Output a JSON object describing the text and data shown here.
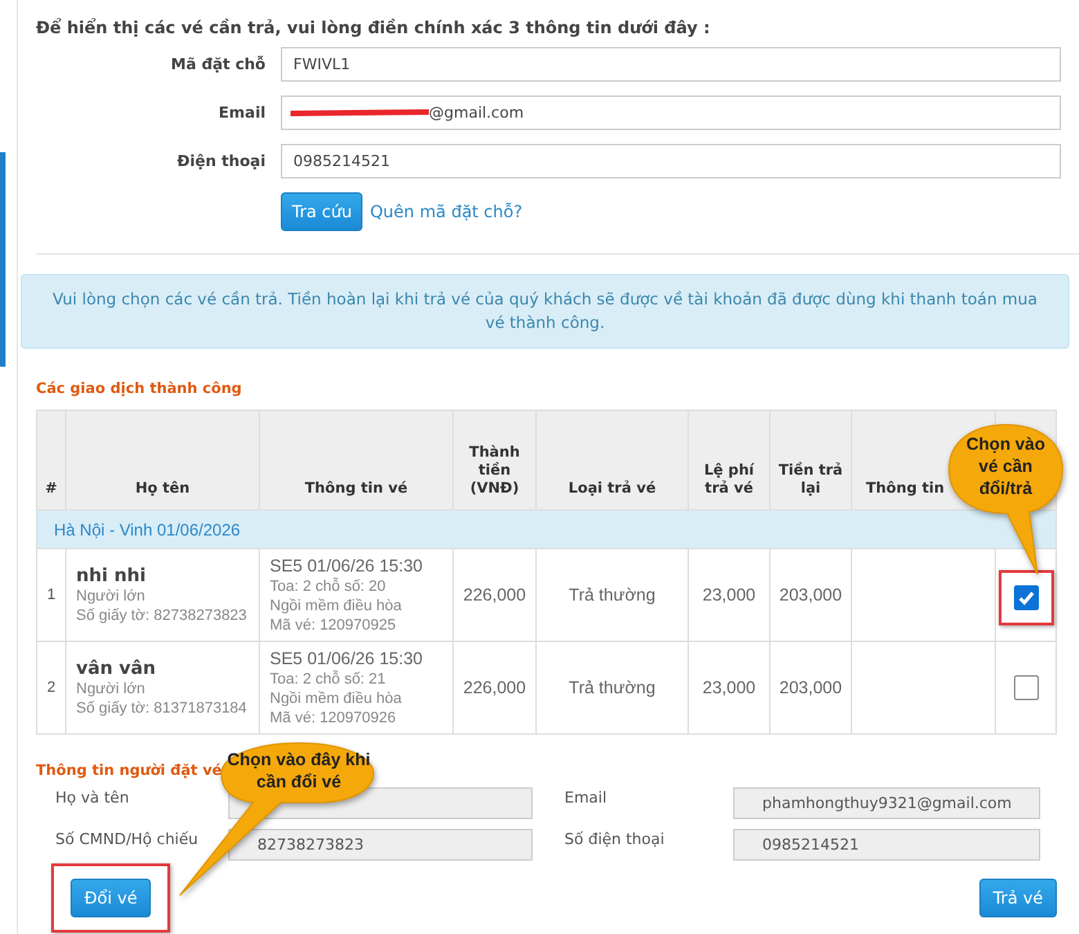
{
  "instructions": "Để hiển thị các vé cần trả, vui lòng điền chính xác 3 thông tin dưới đây :",
  "lookup_form": {
    "fields": [
      {
        "label": "Mã đặt chỗ",
        "value": "FWIVL1",
        "redacted": false
      },
      {
        "label": "Email",
        "value": "@gmail.com",
        "redacted": true
      },
      {
        "label": "Điện thoại",
        "value": "0985214521",
        "redacted": false
      }
    ],
    "search_button": "Tra cứu",
    "forgot_link": "Quên mã đặt chỗ?"
  },
  "notice": "Vui lòng chọn các vé cần trả. Tiền hoàn lại khi trả vé của quý khách sẽ được về tài khoản đã được dùng khi thanh toán mua vé thành công.",
  "transactions": {
    "title": "Các giao dịch thành công",
    "columns": [
      "#",
      "Họ tên",
      "Thông tin vé",
      "Thành tiền (VNĐ)",
      "Loại trả vé",
      "Lệ phí trả vé",
      "Tiền trả lại",
      "Thông tin"
    ],
    "groups": [
      {
        "route": "Hà Nội - Vinh 01/06/2026",
        "rows": [
          {
            "index": "1",
            "name": "nhi nhi",
            "passenger_type": "Người lớn",
            "id_number": "Số giấy tờ: 82738273823",
            "train": "SE5 01/06/26 15:30",
            "seat": "Toa: 2 chỗ số: 20",
            "seat_type": "Ngồi mềm điều hòa",
            "ticket_code": "Mã vé: 120970925",
            "amount": "226,000",
            "refund_type": "Trả thường",
            "fee": "23,000",
            "refund": "203,000",
            "checked": true,
            "highlighted": true
          },
          {
            "index": "2",
            "name": "vân vân",
            "passenger_type": "Người lớn",
            "id_number": "Số giấy tờ: 81371873184",
            "train": "SE5 01/06/26 15:30",
            "seat": "Toa: 2 chỗ số: 21",
            "seat_type": "Ngồi mềm điều hòa",
            "ticket_code": "Mã vé: 120970926",
            "amount": "226,000",
            "refund_type": "Trả thường",
            "fee": "23,000",
            "refund": "203,000",
            "checked": false,
            "highlighted": false
          }
        ]
      }
    ]
  },
  "booker": {
    "title": "Thông tin người đặt vé",
    "fields": [
      {
        "label": "Họ và tên"
      },
      {
        "label": "Email",
        "value": "phamhongthuy9321@gmail.com"
      },
      {
        "label": "Số CMND/Hộ chiếu",
        "value": "82738273823"
      },
      {
        "label": "Số điện thoại",
        "value": "0985214521"
      }
    ]
  },
  "buttons": [
    {
      "label": "Đổi vé",
      "highlighted": true
    },
    {
      "label": "Trả vé",
      "highlighted": false
    }
  ],
  "callouts": [
    {
      "text": "Chọn vào vé cần đổi/trả",
      "kind": "tall"
    },
    {
      "text": "Chọn vào đây khi cần đổi vé",
      "kind": "wide"
    }
  ]
}
